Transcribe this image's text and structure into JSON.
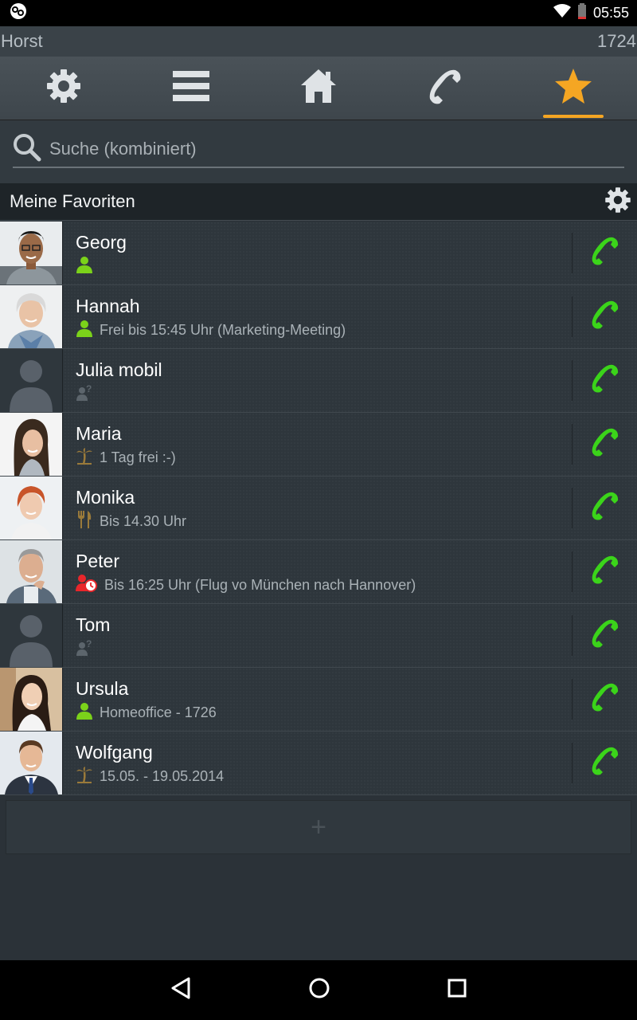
{
  "status_bar": {
    "time": "05:55",
    "left_icon": "app-notification-icon",
    "icons": [
      "wifi-icon",
      "battery-icon"
    ]
  },
  "user": {
    "name": "Horst",
    "extension": "1724"
  },
  "toolbar": {
    "items": [
      {
        "icon": "gear-icon",
        "active": false
      },
      {
        "icon": "menu-icon",
        "active": false
      },
      {
        "icon": "home-icon",
        "active": false
      },
      {
        "icon": "phone-icon",
        "active": false
      },
      {
        "icon": "star-icon",
        "active": true
      }
    ],
    "accent": "#f5a623"
  },
  "search": {
    "placeholder": "Suche (kombiniert)"
  },
  "favorites": {
    "title": "Meine Favoriten",
    "contacts": [
      {
        "name": "Georg",
        "presence": "available",
        "status_text": "",
        "photo": "man-glasses"
      },
      {
        "name": "Hannah",
        "presence": "available",
        "status_text": "Frei bis 15:45 Uhr (Marketing-Meeting)",
        "photo": "woman-white-hair"
      },
      {
        "name": "Julia mobil",
        "presence": "unknown",
        "status_text": "",
        "photo": "placeholder"
      },
      {
        "name": "Maria",
        "presence": "vacation",
        "status_text": "1 Tag frei :-)",
        "photo": "woman-dark-hair"
      },
      {
        "name": "Monika",
        "presence": "lunch",
        "status_text": "Bis 14.30 Uhr",
        "photo": "woman-red-hair"
      },
      {
        "name": "Peter",
        "presence": "busy",
        "status_text": "Bis 16:25 Uhr (Flug vo München nach Hannover)",
        "photo": "man-grey-hair"
      },
      {
        "name": "Tom",
        "presence": "unknown",
        "status_text": "",
        "photo": "placeholder"
      },
      {
        "name": "Ursula",
        "presence": "available",
        "status_text": "Homeoffice - 1726",
        "photo": "woman-long-hair"
      },
      {
        "name": "Wolfgang",
        "presence": "vacation",
        "status_text": "15.05. - 19.05.2014",
        "photo": "man-suit"
      }
    ]
  },
  "add_button": {
    "label": "+"
  },
  "colors": {
    "available": "#7bd21a",
    "call_green": "#3bd41a",
    "busy": "#e8262b"
  },
  "nav": [
    "back-icon",
    "home-circle-icon",
    "recents-icon"
  ]
}
